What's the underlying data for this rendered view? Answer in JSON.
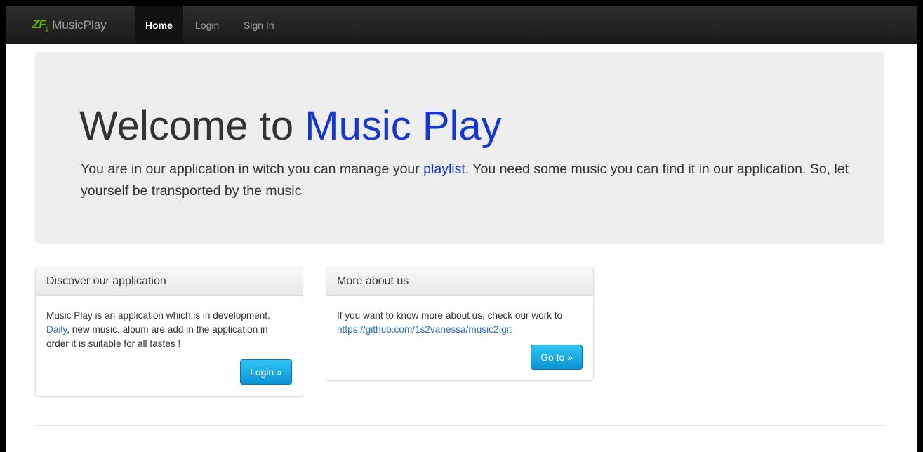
{
  "navbar": {
    "logo_text": "ZF",
    "logo_sub": "2",
    "brand": "MusicPlay",
    "items": [
      {
        "label": "Home",
        "active": true
      },
      {
        "label": "Login",
        "active": false
      },
      {
        "label": "Sign In",
        "active": false
      }
    ]
  },
  "jumbotron": {
    "title_prefix": "Welcome to ",
    "title_accent": "Music Play",
    "text_before": "You are in our application in witch you can manage your ",
    "text_link": "playlist",
    "text_after": ". You need some music you can find it in our application. So, let yourself be transported by the music"
  },
  "panels": [
    {
      "heading": "Discover our application",
      "body_before": "Music Play is an application which,is in development. ",
      "body_link": "Daily",
      "body_after": ", new music, album are add in the application in order it is suitable for all tastes !",
      "button": "Login »"
    },
    {
      "heading": "More about us",
      "body_before": "If you want to know more about us, check our work to ",
      "body_link": "https://github.com/1s2vanessa/music2.git",
      "body_after": "",
      "button": "Go to »"
    }
  ],
  "colors": {
    "accent": "#1437d0",
    "link": "#2a6ab5",
    "button": "#0a94d4",
    "logo": "#68b604"
  }
}
